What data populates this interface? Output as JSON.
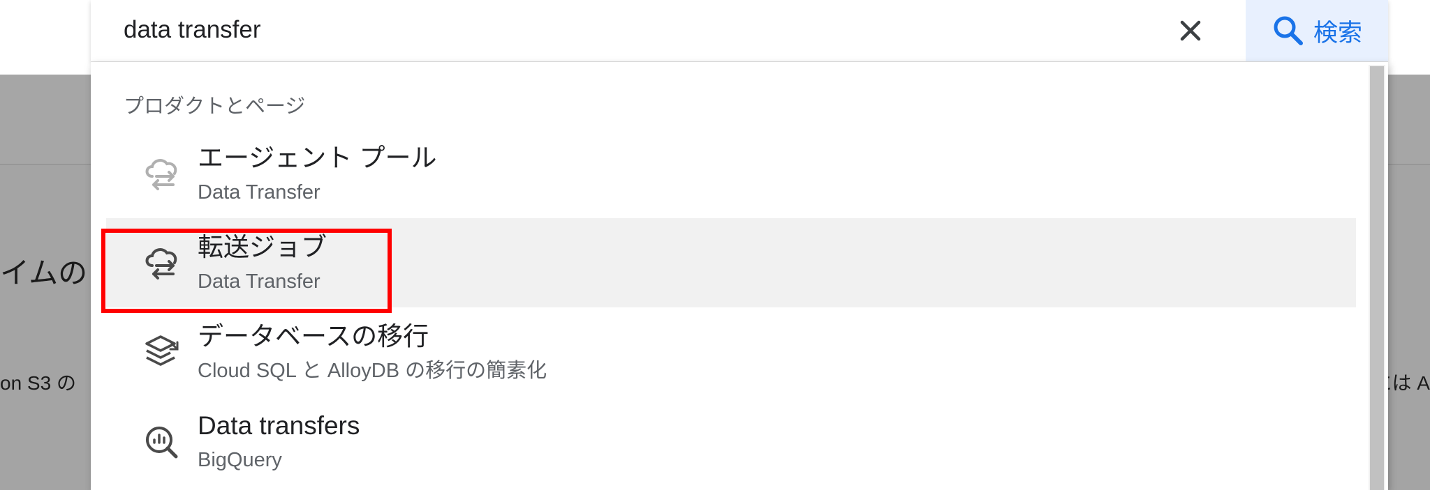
{
  "background": {
    "heading_fragment": "イムの",
    "text_left_fragment": "on S3 の",
    "text_right_fragment": "には A"
  },
  "search": {
    "value": "data transfer",
    "clear_icon": "close-icon",
    "button_icon": "search-icon",
    "button_label": "検索"
  },
  "dropdown": {
    "section_label": "プロダクトとページ",
    "items": [
      {
        "title": "エージェント プール",
        "subtitle": "Data Transfer",
        "icon": "data-transfer-icon"
      },
      {
        "title": "転送ジョブ",
        "subtitle": "Data Transfer",
        "icon": "data-transfer-icon"
      },
      {
        "title": "データベースの移行",
        "subtitle": "Cloud SQL と AlloyDB の移行の簡素化",
        "icon": "database-migration-icon"
      },
      {
        "title": "Data transfers",
        "subtitle": "BigQuery",
        "icon": "bigquery-icon"
      }
    ]
  },
  "colors": {
    "accent": "#1a73e8",
    "highlight_border": "#ff0000",
    "active_row": "#f1f1f1",
    "overlay": "#a4a4a4"
  }
}
